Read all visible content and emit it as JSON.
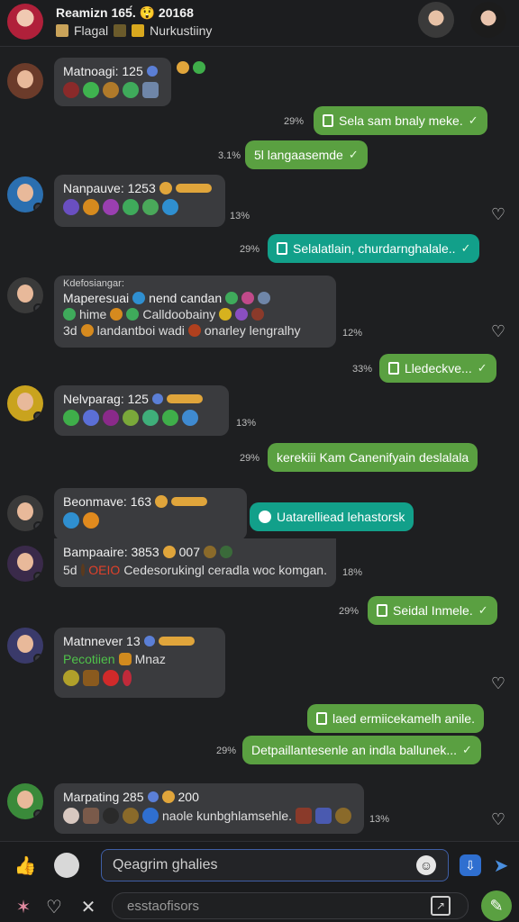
{
  "header": {
    "title": "Reamizn 1​65́. 😲 20168",
    "subtitle_left": "Flagal",
    "subtitle_right": "Nurkustiiny"
  },
  "messages": [
    {
      "kind": "in",
      "name": "Matnoagi: 125",
      "lines": []
    },
    {
      "kind": "out",
      "time": "29%",
      "text": "Sela sam bnaly meke.",
      "color": "green"
    },
    {
      "kind": "out",
      "time": "3.1%",
      "text": "5l langaasemde",
      "color": "green"
    },
    {
      "kind": "in",
      "name": "Nanpauve: 1253",
      "time": "13%",
      "lines": []
    },
    {
      "kind": "out",
      "time": "29%",
      "text": "Selalatlain, churdarnghalale..",
      "color": "teal"
    },
    {
      "kind": "in",
      "name": "Maperesuai",
      "pre": "Kdefosiangar:",
      "name_suffix": "nend candan",
      "lines": [
        "hime",
        "Calldoobainy",
        "3d",
        "landantboi wadi",
        "onarley lengralhy"
      ],
      "time": "12%"
    },
    {
      "kind": "out",
      "time": "33%",
      "text": "Lledeckve...",
      "color": "green"
    },
    {
      "kind": "in",
      "name": "Nelvparag: 125",
      "time": "13%",
      "lines": []
    },
    {
      "kind": "out",
      "time": "29%",
      "text": "kerekiii Kam Canenifyain deslalala",
      "color": "green"
    },
    {
      "kind": "in",
      "name": "Beonmave: 163",
      "lines": []
    },
    {
      "kind": "out_teal",
      "text": "Uatarelliead lehastorsk",
      "color": "teal"
    },
    {
      "kind": "in",
      "name": "Bampaaire: 3853",
      "name_suffix": "007",
      "lines": [
        "5d",
        "OEIO",
        "Cedesorukingl ceradla woc komgan."
      ],
      "time": "18%"
    },
    {
      "kind": "out",
      "time": "29%",
      "text": "Seidal Inmele.",
      "color": "green"
    },
    {
      "kind": "in",
      "name": "Matnnever 13",
      "lines": [
        "Pecotiien",
        "Mnaz"
      ]
    },
    {
      "kind": "out",
      "text": "laed ermiicekamelh anile.",
      "color": "green"
    },
    {
      "kind": "out",
      "time": "29%",
      "text": "Detpaillantesenle an indla ballunek...",
      "color": "green"
    },
    {
      "kind": "in",
      "name": "Marpating 285",
      "name_suffix": "200",
      "lines": [
        "naole kunbghlamsehle."
      ],
      "time": "13%"
    }
  ],
  "composer": {
    "placeholder": "Qeagrim ghalies",
    "placeholder2": "esstaofisors"
  },
  "colors": {
    "green": "#5aa041",
    "teal": "#12a08a",
    "incoming": "#3a3b3e",
    "background": "#1e1f21"
  }
}
